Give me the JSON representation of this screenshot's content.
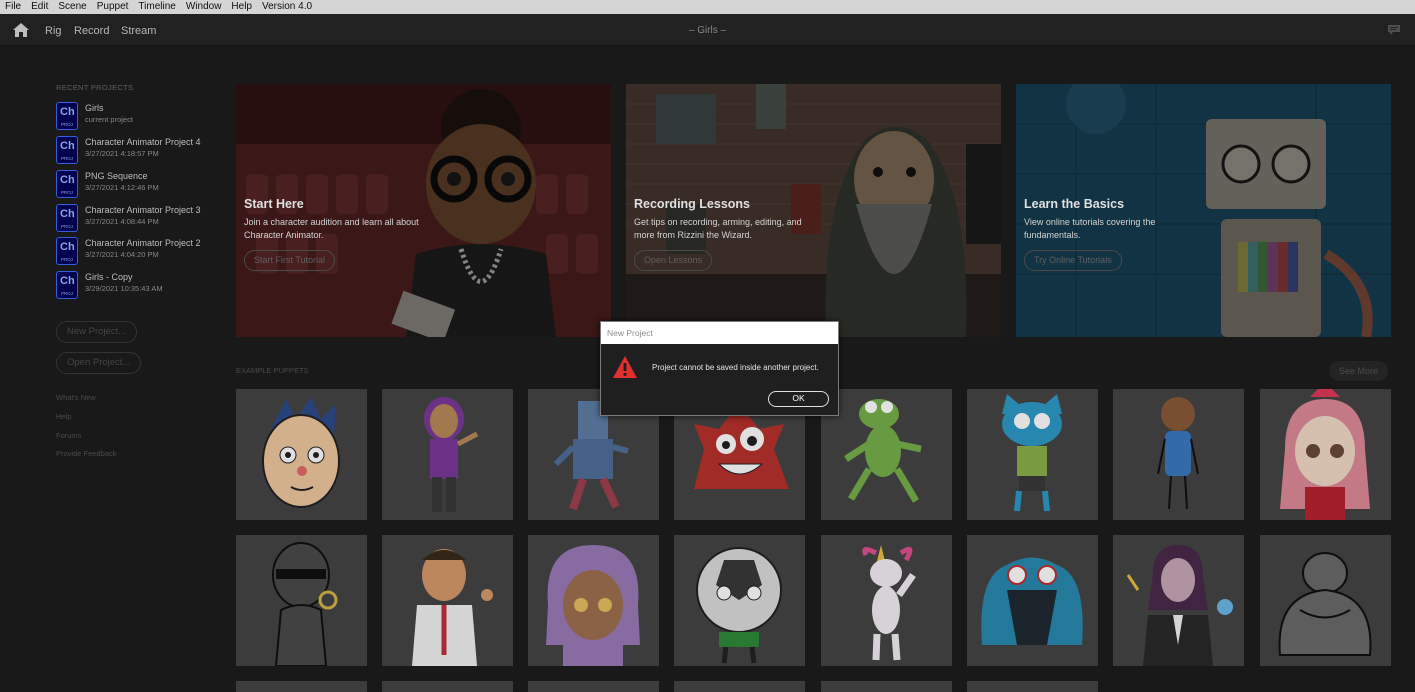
{
  "menu": [
    "File",
    "Edit",
    "Scene",
    "Puppet",
    "Timeline",
    "Window",
    "Help",
    "Version 4.0"
  ],
  "header": {
    "tabs": [
      "Rig",
      "Record",
      "Stream"
    ],
    "title": "– Girls –"
  },
  "sidebar": {
    "recent_label": "RECENT PROJECTS",
    "icon_text": "Ch",
    "icon_subtext": "PROJ",
    "projects": [
      {
        "name": "Girls",
        "detail": "current project"
      },
      {
        "name": "Character Animator Project 4",
        "detail": "3/27/2021 4:18:57 PM"
      },
      {
        "name": "PNG Sequence",
        "detail": "3/27/2021 4:12:46 PM"
      },
      {
        "name": "Character Animator Project 3",
        "detail": "3/27/2021 4:08:44 PM"
      },
      {
        "name": "Character Animator Project 2",
        "detail": "3/27/2021 4:04:20 PM"
      },
      {
        "name": "Girls - Copy",
        "detail": "3/29/2021 10:35:43 AM"
      }
    ],
    "new_project": "New Project...",
    "open_project": "Open Project...",
    "links": [
      "What's New",
      "Help",
      "Forums",
      "Provide Feedback"
    ]
  },
  "heroes": [
    {
      "title": "Start Here",
      "desc": "Join a character audition and learn all about Character Animator.",
      "button": "Start First Tutorial"
    },
    {
      "title": "Recording Lessons",
      "desc": "Get tips on recording, arming, editing, and more from Rizzini the Wizard.",
      "button": "Open Lessons"
    },
    {
      "title": "Learn the Basics",
      "desc": "View online tutorials covering the fundamentals.",
      "button": "Try Online Tutorials"
    }
  ],
  "examples": {
    "label": "EXAMPLE PUPPETS",
    "see_more": "See More"
  },
  "dialog": {
    "title": "New Project",
    "message": "Project cannot be saved inside another project.",
    "ok": "OK",
    "icon": "warning-icon"
  }
}
